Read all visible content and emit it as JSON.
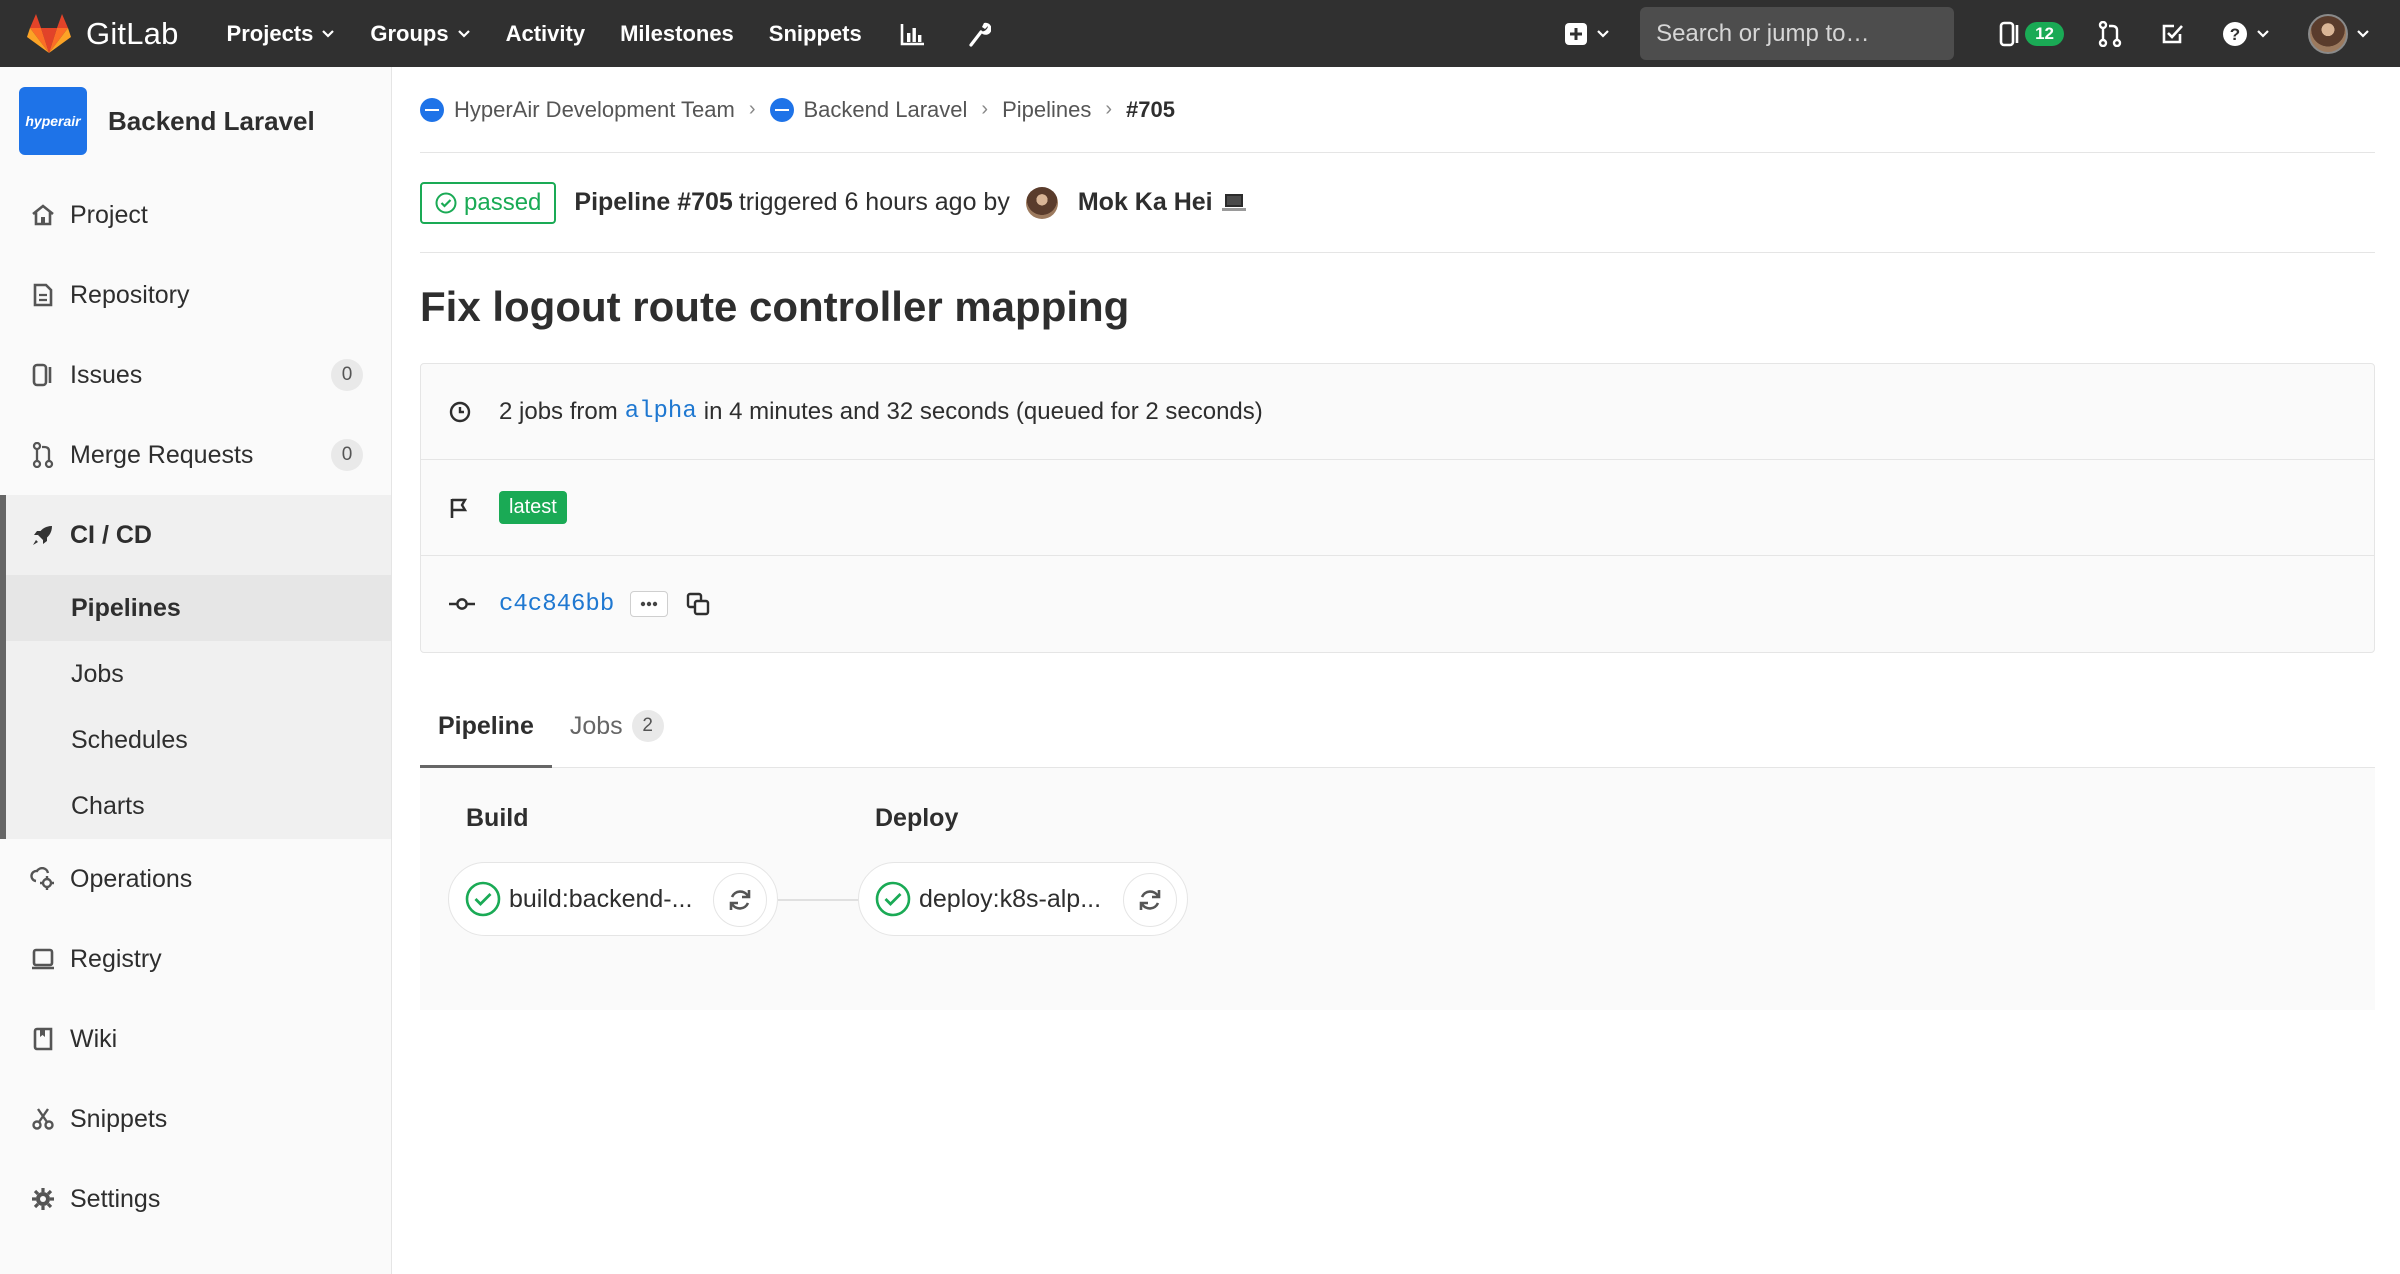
{
  "navbar": {
    "brand": "GitLab",
    "links": {
      "projects": "Projects",
      "groups": "Groups",
      "activity": "Activity",
      "milestones": "Milestones",
      "snippets": "Snippets"
    },
    "search_placeholder": "Search or jump to…",
    "issues_count": "12"
  },
  "sidebar": {
    "project_name": "Backend Laravel",
    "project_logo_text": "hyperair",
    "items": {
      "project": "Project",
      "repository": "Repository",
      "issues": "Issues",
      "issues_count": "0",
      "merge_requests": "Merge Requests",
      "merge_requests_count": "0",
      "cicd": "CI / CD",
      "operations": "Operations",
      "registry": "Registry",
      "wiki": "Wiki",
      "snippets": "Snippets",
      "settings": "Settings"
    },
    "cicd_sub": {
      "pipelines": "Pipelines",
      "jobs": "Jobs",
      "schedules": "Schedules",
      "charts": "Charts"
    }
  },
  "breadcrumb": {
    "group": "HyperAir Development Team",
    "project": "Backend Laravel",
    "section": "Pipelines",
    "current": "#705"
  },
  "pipeline": {
    "status": "passed",
    "label": "Pipeline #705",
    "triggered": "triggered 6 hours ago by",
    "user": "Mok Ka Hei",
    "commit_title": "Fix logout route controller mapping",
    "jobs_prefix": "2 jobs from",
    "ref": "alpha",
    "duration_text": "in 4 minutes and 32 seconds (queued for 2 seconds)",
    "tag": "latest",
    "sha": "c4c846bb"
  },
  "tabs": {
    "pipeline": "Pipeline",
    "jobs": "Jobs",
    "jobs_count": "2"
  },
  "stages": {
    "build": {
      "title": "Build",
      "job": "build:backend-..."
    },
    "deploy": {
      "title": "Deploy",
      "job": "deploy:k8s-alp..."
    }
  },
  "colors": {
    "navbar": "#303030",
    "success": "#1aaa55",
    "link": "#1f78d1"
  }
}
